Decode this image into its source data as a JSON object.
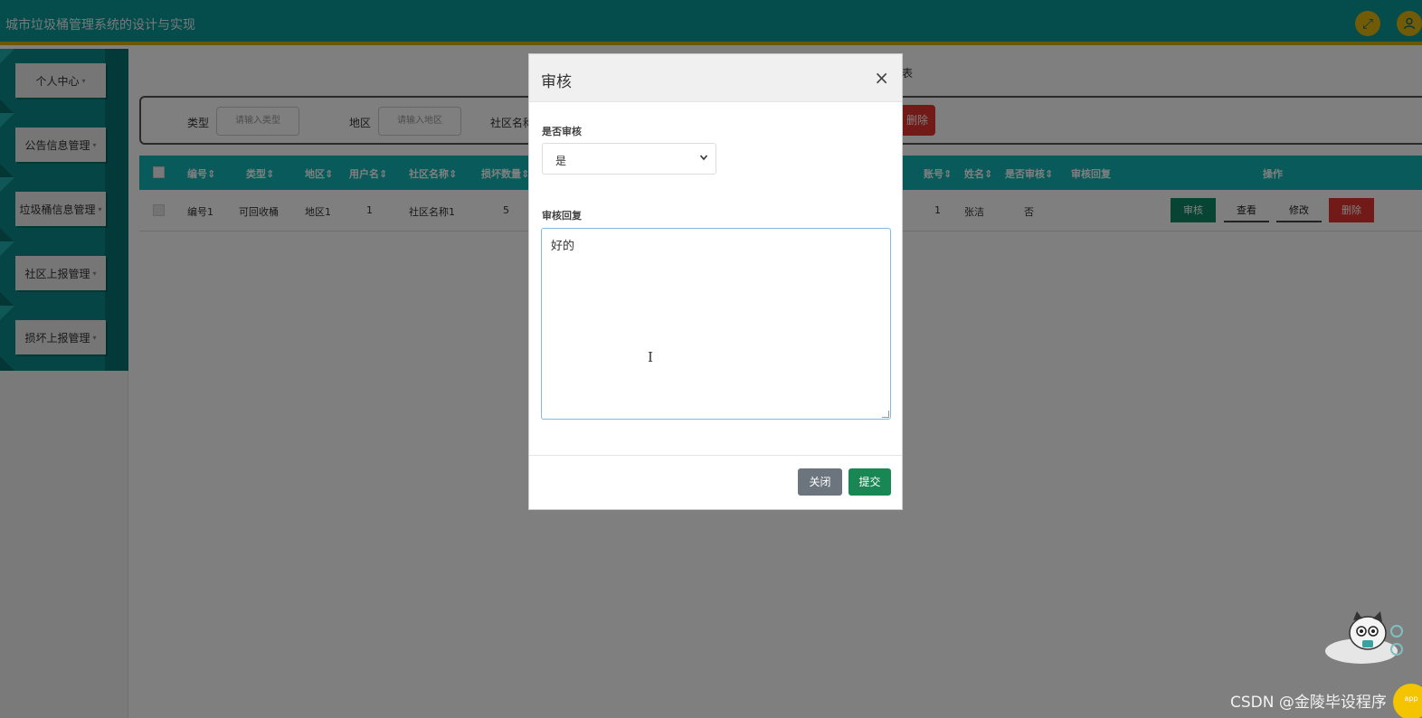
{
  "app": {
    "title": "城市垃圾桶管理系统的设计与实现"
  },
  "header": {
    "fullscreen_icon": "expand-icon",
    "user_icon": "user-icon"
  },
  "sidebar": {
    "items": [
      {
        "label": "个人中心"
      },
      {
        "label": "公告信息管理"
      },
      {
        "label": "垃圾桶信息管理"
      },
      {
        "label": "社区上报管理"
      },
      {
        "label": "损坏上报管理"
      }
    ]
  },
  "main": {
    "breadcrumb_tail": "表",
    "search": {
      "type_label": "类型",
      "type_placeholder": "请输入类型",
      "region_label": "地区",
      "region_placeholder": "请输入地区",
      "community_label": "社区名称",
      "delete_label": "删除"
    },
    "table": {
      "headers": {
        "id": "编号",
        "type": "类型",
        "region": "地区",
        "username": "用户名",
        "community": "社区名称",
        "damage_count": "损坏数量",
        "account": "账号",
        "name": "姓名",
        "audited": "是否审核",
        "reply": "审核回复",
        "actions": "操作"
      },
      "sort_glyph": "⇕",
      "rows": [
        {
          "id": "编号1",
          "type": "可回收桶",
          "region": "地区1",
          "username": "1",
          "community": "社区名称1",
          "damage_count": "5",
          "account": "1",
          "name": "张洁",
          "audited": "否",
          "reply": ""
        }
      ],
      "actions": {
        "audit": "审核",
        "view": "查看",
        "edit": "修改",
        "delete": "删除"
      }
    }
  },
  "modal": {
    "title": "审核",
    "close_glyph": "×",
    "audit_label": "是否审核",
    "audit_value": "是",
    "reply_label": "审核回复",
    "reply_value": "好的",
    "close_button": "关闭",
    "submit_button": "提交"
  },
  "watermark": "CSDN @金陵毕设程序",
  "colors": {
    "header": "#0a9b9b",
    "accent_yellow": "#d6b10c",
    "table_head": "#13b6b6",
    "danger": "#e3342f",
    "success": "#198754"
  }
}
